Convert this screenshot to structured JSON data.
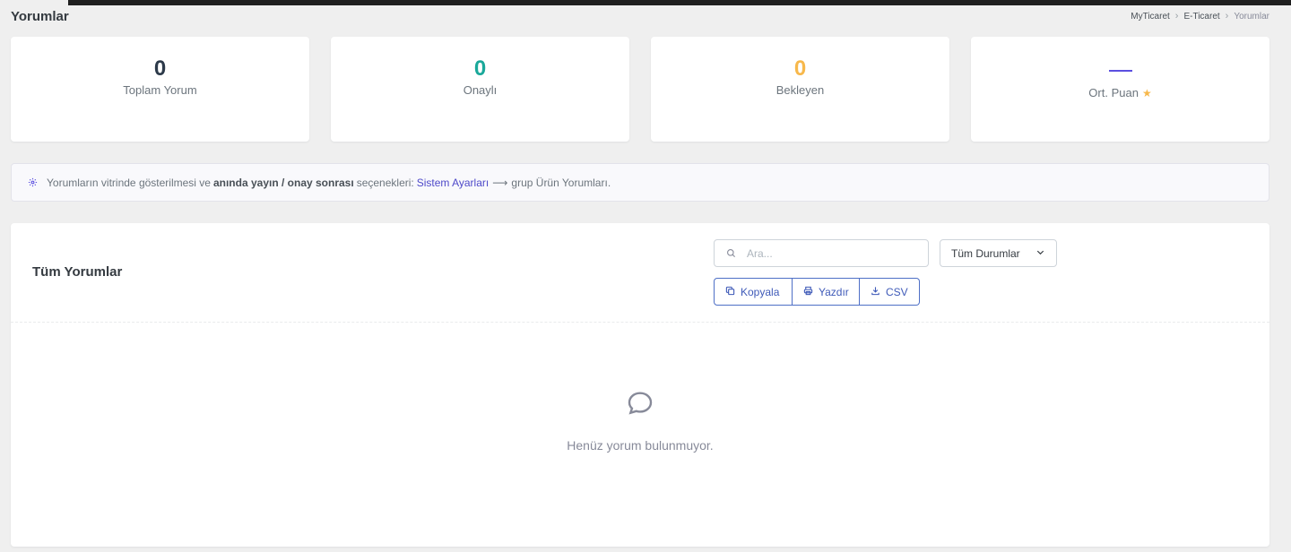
{
  "page": {
    "title": "Yorumlar",
    "breadcrumb": [
      "MyTicaret",
      "E-Ticaret",
      "Yorumlar"
    ]
  },
  "stats": [
    {
      "value": "0",
      "label": "Toplam Yorum",
      "color": "#2d3a4a"
    },
    {
      "value": "0",
      "label": "Onaylı",
      "color": "#1aa89a"
    },
    {
      "value": "0",
      "label": "Bekleyen",
      "color": "#f7b84b"
    },
    {
      "value": "",
      "label": "Ort. Puan",
      "color": "#5b4fe0",
      "icon": "star-icon"
    }
  ],
  "info": {
    "text_before": "Yorumların vitrinde gösterilmesi ve",
    "strong": "anında yayın / onay sonrası",
    "text_mid": "seçenekleri:",
    "link": "Sistem Ayarları",
    "arrow": "⟶",
    "text_after": "grup Ürün Yorumları."
  },
  "comments": {
    "title": "Tüm Yorumlar",
    "search_placeholder": "Ara...",
    "status_filter": "Tüm Durumlar",
    "buttons": {
      "copy": "Kopyala",
      "print": "Yazdır",
      "csv": "CSV"
    },
    "empty_text": "Henüz yorum bulunmuyor."
  }
}
